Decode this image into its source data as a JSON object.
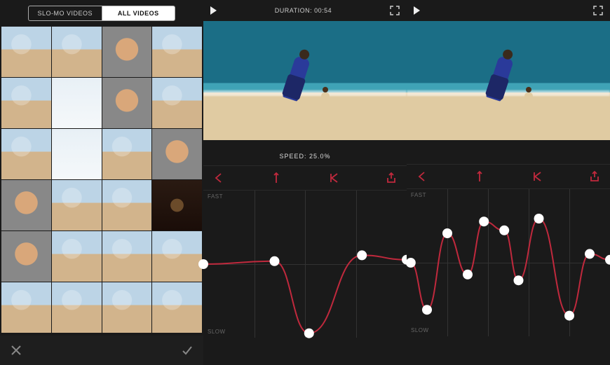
{
  "colors": {
    "accent": "#c0293d",
    "bg": "#1a1a1a"
  },
  "left_panel": {
    "tabs": [
      {
        "label": "SLO-MO VIDEOS",
        "selected": false
      },
      {
        "label": "ALL VIDEOS",
        "selected": true
      }
    ],
    "thumbnail_count": 24
  },
  "editor": {
    "duration_label": "DURATION:",
    "duration_value": "00:54",
    "speed_label": "SPEED:",
    "speed_value": "25.0%",
    "axis_fast": "FAST",
    "axis_slow": "SLOW"
  },
  "curve_mid": {
    "points": [
      {
        "x": 0.0,
        "y": 0.5
      },
      {
        "x": 0.35,
        "y": 0.48
      },
      {
        "x": 0.52,
        "y": 0.97
      },
      {
        "x": 0.78,
        "y": 0.44
      },
      {
        "x": 1.0,
        "y": 0.47
      }
    ]
  },
  "curve_right": {
    "points": [
      {
        "x": 0.02,
        "y": 0.5
      },
      {
        "x": 0.1,
        "y": 0.82
      },
      {
        "x": 0.2,
        "y": 0.3
      },
      {
        "x": 0.3,
        "y": 0.58
      },
      {
        "x": 0.38,
        "y": 0.22
      },
      {
        "x": 0.48,
        "y": 0.28
      },
      {
        "x": 0.55,
        "y": 0.62
      },
      {
        "x": 0.65,
        "y": 0.2
      },
      {
        "x": 0.8,
        "y": 0.86
      },
      {
        "x": 0.9,
        "y": 0.44
      },
      {
        "x": 1.0,
        "y": 0.48
      }
    ]
  }
}
